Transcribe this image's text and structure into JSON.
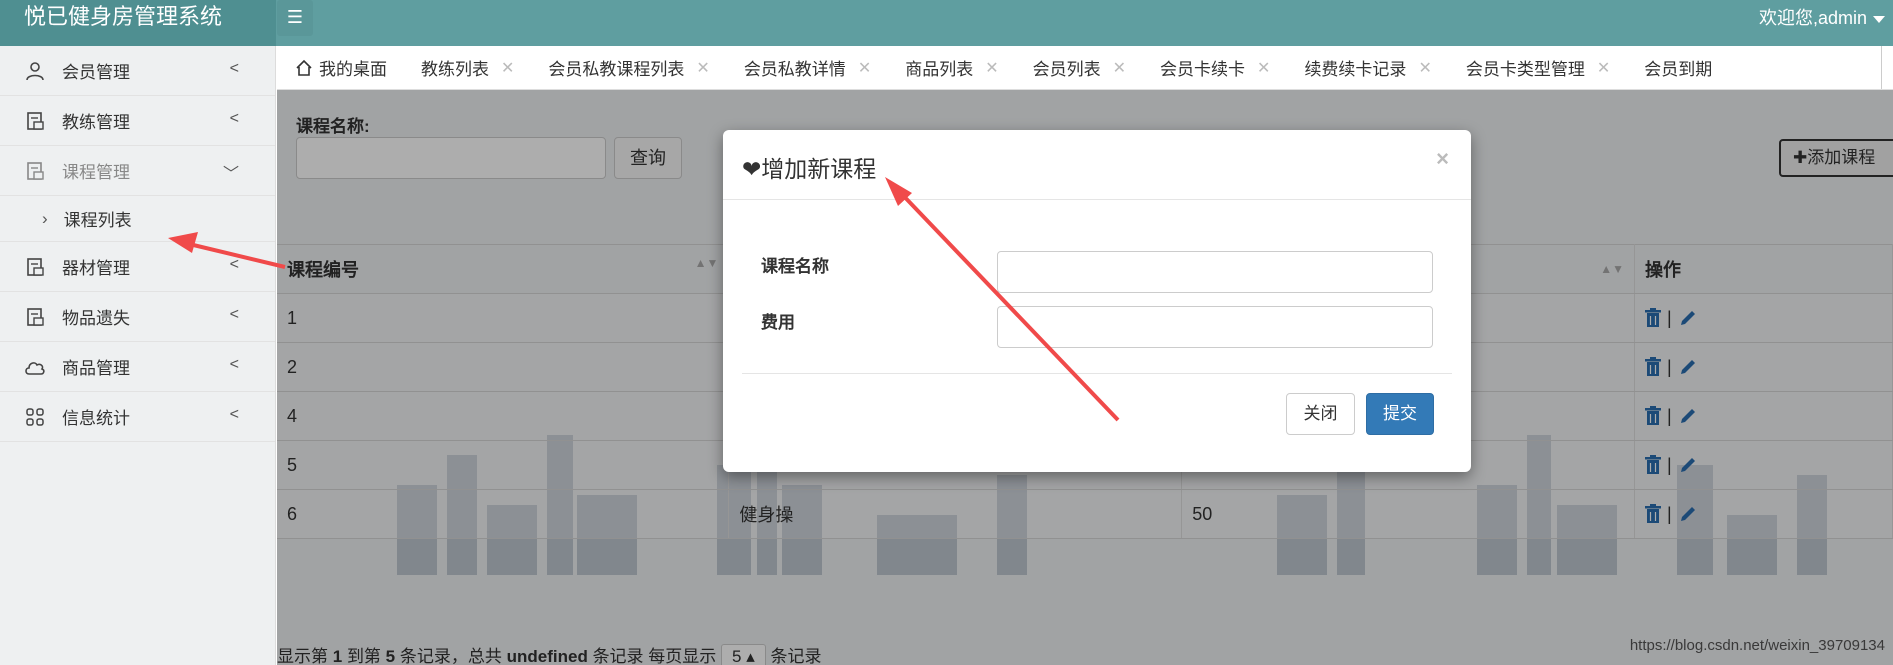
{
  "app": {
    "title": "悦已健身房管理系统",
    "menu_icon": "list-icon",
    "welcome": "欢迎您,admin"
  },
  "sidebar": {
    "items": [
      {
        "label": "会员管理",
        "icon": "user-icon"
      },
      {
        "label": "教练管理",
        "icon": "document-icon"
      },
      {
        "label": "课程管理",
        "icon": "document-icon",
        "expanded": true
      },
      {
        "label": "器材管理",
        "icon": "document-icon"
      },
      {
        "label": "物品遗失",
        "icon": "document-icon"
      },
      {
        "label": "商品管理",
        "icon": "cloud-icon"
      },
      {
        "label": "信息统计",
        "icon": "grid-icon"
      }
    ],
    "subitems": [
      {
        "label": "课程列表"
      }
    ]
  },
  "tabs": [
    {
      "label": "我的桌面",
      "icon": "home-icon"
    },
    {
      "label": "教练列表"
    },
    {
      "label": "会员私教课程列表"
    },
    {
      "label": "会员私教详情"
    },
    {
      "label": "商品列表"
    },
    {
      "label": "会员列表"
    },
    {
      "label": "会员卡续卡"
    },
    {
      "label": "续费续卡记录"
    },
    {
      "label": "会员卡类型管理"
    },
    {
      "label": "会员到期"
    }
  ],
  "search": {
    "label": "课程名称:",
    "button": "查询",
    "add_button": "添加课程"
  },
  "table": {
    "headers": [
      "课程编号",
      "",
      "",
      "操作"
    ],
    "rows": [
      {
        "id": "1",
        "name": "",
        "fee": ""
      },
      {
        "id": "2",
        "name": "",
        "fee": ""
      },
      {
        "id": "4",
        "name": "",
        "fee": ""
      },
      {
        "id": "5",
        "name": "",
        "fee": ""
      },
      {
        "id": "6",
        "name": "健身操",
        "fee": "50"
      }
    ],
    "row_actions": [
      "trash-icon",
      "pencil-icon"
    ]
  },
  "pager": {
    "p1": "显示第",
    "from": "1",
    "p2": "到第",
    "to": "5",
    "p3": "条记录，总共",
    "total": "undefined",
    "p4": "条记录 每页显示",
    "page_size": "5",
    "p5": "条记录"
  },
  "watermark": "https://blog.csdn.net/weixin_39709134",
  "modal": {
    "title": "增加新课程",
    "close_x": "×",
    "fields": [
      {
        "label": "课程名称",
        "value": ""
      },
      {
        "label": "费用",
        "value": ""
      }
    ],
    "cancel": "关闭",
    "submit": "提交"
  },
  "colors": {
    "topbar": "#5f9ea0",
    "primary": "#337ab7",
    "annotation_arrow": "#f04a4a"
  }
}
